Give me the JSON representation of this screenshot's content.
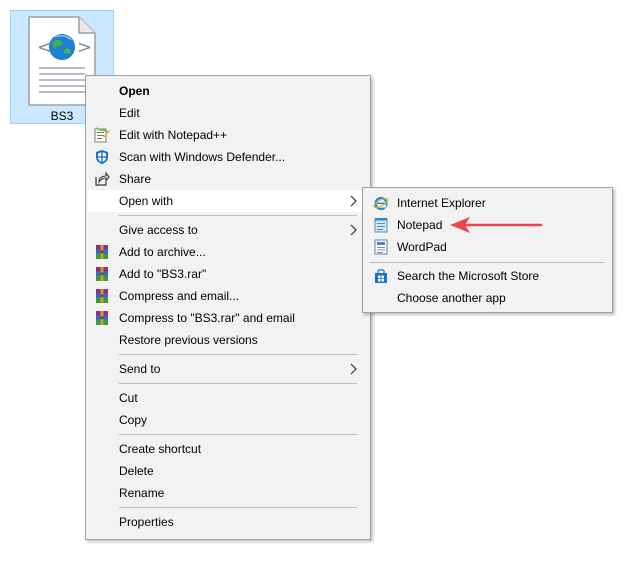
{
  "desktop_file": {
    "name": "BS3"
  },
  "context_menu": {
    "items": [
      {
        "label": "Open",
        "bold": true,
        "icon": "none"
      },
      {
        "label": "Edit",
        "icon": "none"
      },
      {
        "label": "Edit with Notepad++",
        "icon": "notepadpp-icon"
      },
      {
        "label": "Scan with Windows Defender...",
        "icon": "defender-shield-icon"
      },
      {
        "label": "Share",
        "icon": "share-icon"
      },
      {
        "label": "Open with",
        "icon": "none",
        "submenu": true
      },
      {
        "label": "Give access to",
        "icon": "none",
        "submenu": true
      },
      {
        "label": "Add to archive...",
        "icon": "winrar-icon"
      },
      {
        "label": "Add to \"BS3.rar\"",
        "icon": "winrar-icon"
      },
      {
        "label": "Compress and email...",
        "icon": "winrar-icon"
      },
      {
        "label": "Compress to \"BS3.rar\" and email",
        "icon": "winrar-icon"
      },
      {
        "label": "Restore previous versions",
        "icon": "none"
      },
      {
        "label": "Send to",
        "icon": "none",
        "submenu": true
      },
      {
        "label": "Cut",
        "icon": "none"
      },
      {
        "label": "Copy",
        "icon": "none"
      },
      {
        "label": "Create shortcut",
        "icon": "none"
      },
      {
        "label": "Delete",
        "icon": "none"
      },
      {
        "label": "Rename",
        "icon": "none"
      },
      {
        "label": "Properties",
        "icon": "none"
      }
    ]
  },
  "open_with_submenu": {
    "items": [
      {
        "label": "Internet Explorer",
        "icon": "internet-explorer-icon"
      },
      {
        "label": "Notepad",
        "icon": "notepad-icon"
      },
      {
        "label": "WordPad",
        "icon": "wordpad-icon"
      },
      {
        "label": "Search the Microsoft Store",
        "icon": "microsoft-store-icon"
      },
      {
        "label": "Choose another app",
        "icon": "none"
      }
    ]
  },
  "colors": {
    "menu_bg": "#f2f2f2",
    "hover_bg": "#ffffff",
    "selection_bg": "#cce8ff",
    "arrow": "#e8464d"
  }
}
